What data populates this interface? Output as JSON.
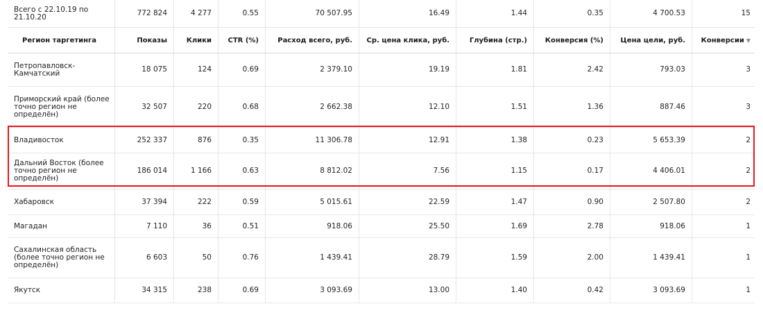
{
  "total": {
    "period": "Всего с 22.10.19 по 21.10.20",
    "values": [
      "772 824",
      "4 277",
      "0.55",
      "70 507.95",
      "16.49",
      "1.44",
      "0.35",
      "4 700.53",
      "15"
    ]
  },
  "headers": [
    "Регион таргетинга",
    "Показы",
    "Клики",
    "CTR (%)",
    "Расход всего, руб.",
    "Ср. цена клика, руб.",
    "Глубина (стр.)",
    "Конверсия (%)",
    "Цена цели, руб.",
    "Конверсии"
  ],
  "sort_icon": "sort-descending-arrow",
  "highlight_color": "#e8141c",
  "rows": [
    {
      "region": "Петропавловск-Камчатский",
      "cells": [
        "18 075",
        "124",
        "0.69",
        "2 379.10",
        "19.19",
        "1.81",
        "2.42",
        "793.03",
        "3"
      ]
    },
    {
      "region": "Приморский край (более точно регион не определён)",
      "cells": [
        "32 507",
        "220",
        "0.68",
        "2 662.38",
        "12.10",
        "1.51",
        "1.36",
        "887.46",
        "3"
      ]
    },
    {
      "region": "Владивосток",
      "cells": [
        "252 337",
        "876",
        "0.35",
        "11 306.78",
        "12.91",
        "1.38",
        "0.23",
        "5 653.39",
        "2"
      ]
    },
    {
      "region": "Дальний Восток (более точно регион не определён)",
      "cells": [
        "186 014",
        "1 166",
        "0.63",
        "8 812.02",
        "7.56",
        "1.15",
        "0.17",
        "4 406.01",
        "2"
      ]
    },
    {
      "region": "Хабаровск",
      "cells": [
        "37 394",
        "222",
        "0.59",
        "5 015.61",
        "22.59",
        "1.47",
        "0.90",
        "2 507.80",
        "2"
      ]
    },
    {
      "region": "Магадан",
      "cells": [
        "7 110",
        "36",
        "0.51",
        "918.06",
        "25.50",
        "1.69",
        "2.78",
        "918.06",
        "1"
      ]
    },
    {
      "region": "Сахалинская область (более точно регион не определён)",
      "cells": [
        "6 603",
        "50",
        "0.76",
        "1 439.41",
        "28.79",
        "1.59",
        "2.00",
        "1 439.41",
        "1"
      ]
    },
    {
      "region": "Якутск",
      "cells": [
        "34 315",
        "238",
        "0.69",
        "3 093.69",
        "13.00",
        "1.40",
        "0.42",
        "3 093.69",
        "1"
      ]
    }
  ]
}
